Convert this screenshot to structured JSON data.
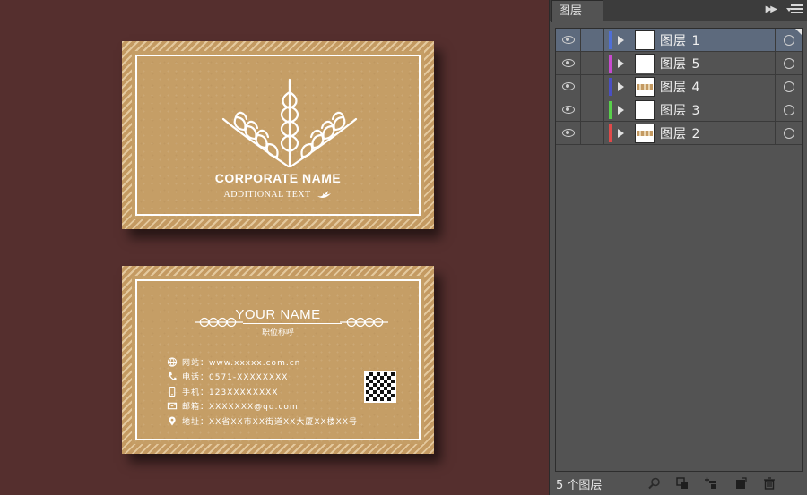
{
  "front_card": {
    "corporate_name": "CORPORATE NAME",
    "additional_text": "ADDITIONAL TEXT"
  },
  "back_card": {
    "your_name": "YOUR NAME",
    "job_title": "职位称呼",
    "contacts": [
      {
        "icon": "globe-icon",
        "text": "网站：www.xxxxx.com.cn"
      },
      {
        "icon": "phone-icon",
        "text": "电话：0571-XXXXXXXX"
      },
      {
        "icon": "mobile-icon",
        "text": "手机：123XXXXXXXX"
      },
      {
        "icon": "mail-icon",
        "text": "邮箱：XXXXXXX@qq.com"
      },
      {
        "icon": "location-icon",
        "text": "地址：XX省XX市XX街道XX大厦XX楼XX号"
      }
    ]
  },
  "panel": {
    "tab_title": "图层",
    "layer_count": "5 个图层",
    "layers": [
      {
        "name": "图层 1",
        "color": "#4f6fd6",
        "thumb": "blank",
        "selected": true
      },
      {
        "name": "图层 5",
        "color": "#c84bd0",
        "thumb": "blank",
        "selected": false
      },
      {
        "name": "图层 4",
        "color": "#4a4fc4",
        "thumb": "kraft",
        "selected": false
      },
      {
        "name": "图层 3",
        "color": "#58d04b",
        "thumb": "blank",
        "selected": false
      },
      {
        "name": "图层 2",
        "color": "#e04a4a",
        "thumb": "kraft",
        "selected": false
      }
    ],
    "bottom_icons": [
      "search-icon",
      "clipping-mask-icon",
      "new-sublayer-icon",
      "new-layer-icon",
      "trash-icon"
    ]
  },
  "colors": {
    "background": "#552f2e",
    "kraft": "#c49a62",
    "panel": "#535353",
    "selected_row": "#5d6a7d"
  }
}
